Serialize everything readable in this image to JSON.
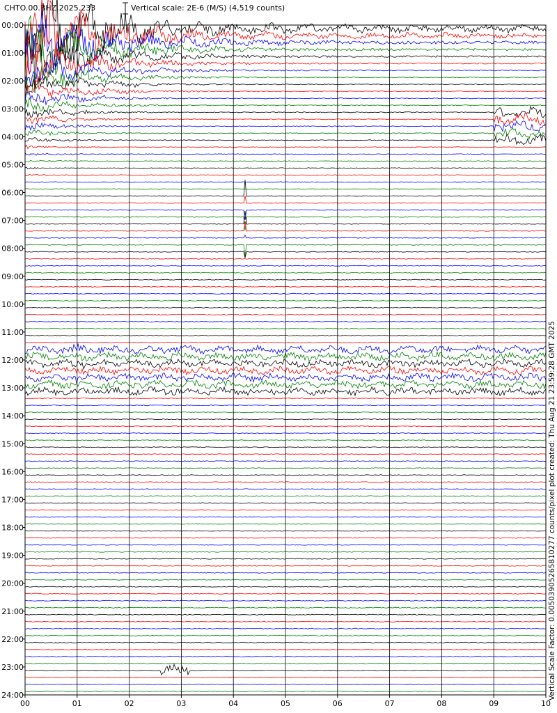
{
  "chart_data": {
    "type": "line",
    "title": "CHTO.00.BHZ.2025.233",
    "scale_label": "Vertical scale: 2E-6 (M/S) (4,519 counts)",
    "side_label": "Vertical Scale Factor: 0.00503905265810277 counts/pixel plot created: Thu Aug 21 23:59:28 GMT 2025",
    "y_tick_labels": [
      "00:00",
      "01:00",
      "02:00",
      "03:00",
      "04:00",
      "05:00",
      "06:00",
      "07:00",
      "08:00",
      "09:00",
      "10:00",
      "11:00",
      "12:00",
      "13:00",
      "14:00",
      "15:00",
      "16:00",
      "17:00",
      "18:00",
      "19:00",
      "20:00",
      "21:00",
      "22:00",
      "23:00",
      "24:00"
    ],
    "x_tick_labels": [
      "00",
      "01",
      "02",
      "03",
      "04",
      "05",
      "06",
      "07",
      "08",
      "09",
      "10"
    ],
    "lines_per_hour": 4,
    "trace_colors": [
      "#000000",
      "#ff0000",
      "#0000ff",
      "#008000"
    ],
    "grid_color": "#000000",
    "xlim": [
      0,
      10
    ],
    "ylim": [
      0,
      24
    ],
    "events": [
      {
        "name": "large teleseism onset",
        "start_hour": 0.0,
        "end_hour": 8.0,
        "start_min": 0.0,
        "end_min": 10.0
      },
      {
        "name": "sharp spike",
        "start_hour": 6.0,
        "end_hour": 8.0,
        "start_min": 4.2,
        "end_min": 4.25
      },
      {
        "name": "local event",
        "start_hour": 11.5,
        "end_hour": 12.5,
        "start_min": 0.9,
        "end_min": 3.2
      },
      {
        "name": "long-period surface waves",
        "start_hour": 11.5,
        "end_hour": 13.0,
        "start_min": 0.0,
        "end_min": 10.0
      },
      {
        "name": "burst",
        "start_hour": 3.0,
        "end_hour": 4.0,
        "start_min": 9.0,
        "end_min": 10.0
      },
      {
        "name": "burst",
        "start_hour": 22.8,
        "end_hour": 23.2,
        "start_min": 2.6,
        "end_min": 3.2
      }
    ]
  }
}
